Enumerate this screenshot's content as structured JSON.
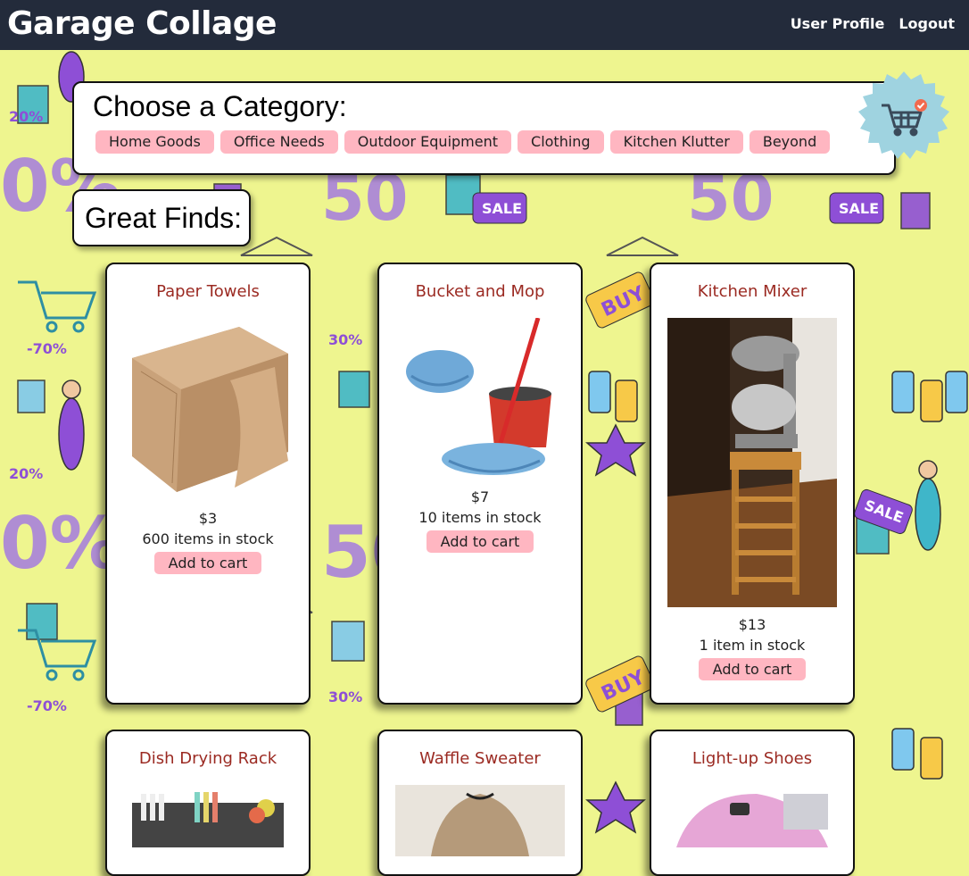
{
  "header": {
    "brand": "Garage Collage",
    "nav": {
      "profile": "User Profile",
      "logout": "Logout"
    }
  },
  "categories": {
    "title": "Choose a Category:",
    "items": [
      "Home Goods",
      "Office Needs",
      "Outdoor Equipment",
      "Clothing",
      "Kitchen Klutter",
      "Beyond"
    ]
  },
  "cart": {
    "icon": "shopping-cart-icon"
  },
  "finds": {
    "title": "Great Finds:"
  },
  "products": [
    {
      "name": "Paper Towels",
      "price": "$3",
      "stock": "600 items in stock",
      "button": "Add to cart"
    },
    {
      "name": "Bucket and Mop",
      "price": "$7",
      "stock": "10 items in stock",
      "button": "Add to cart"
    },
    {
      "name": "Kitchen Mixer",
      "price": "$13",
      "stock": "1 item in stock",
      "button": "Add to cart"
    },
    {
      "name": "Dish Drying Rack"
    },
    {
      "name": "Waffle Sweater"
    },
    {
      "name": "Light-up Shoes"
    }
  ],
  "colors": {
    "topbar": "#232b3b",
    "chip": "#ffb6c1",
    "product_title": "#9b2a22",
    "background": "#eef58f",
    "cart_badge": "#9fd3e0"
  }
}
